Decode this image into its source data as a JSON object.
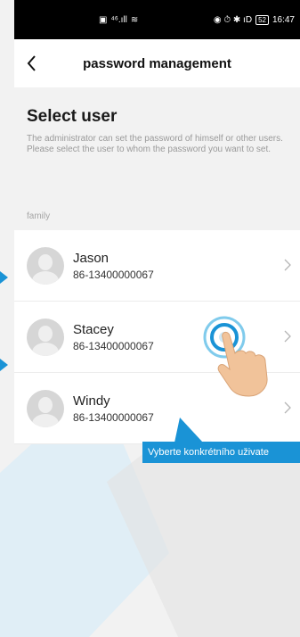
{
  "status_bar": {
    "signal_text": "⁴⁶.ıll",
    "right_icons": "◉ ⏱ ✱ ıD",
    "battery": "52",
    "time": "16:47"
  },
  "nav": {
    "title": "password management",
    "back_icon": "chevron-left"
  },
  "header": {
    "title": "Select user",
    "description": "The administrator can set the password of himself or other users. Please select the user to whom the password you want to set."
  },
  "section": {
    "label": "family"
  },
  "users": [
    {
      "name": "Jason",
      "phone": "86-13400000067"
    },
    {
      "name": "Stacey",
      "phone": "86-13400000067"
    },
    {
      "name": "Windy",
      "phone": "86-13400000067"
    }
  ],
  "callout": {
    "text": "Vyberte konkrétního uživate"
  },
  "colors": {
    "accent": "#1a93d6",
    "background": "#f2f2f2",
    "card": "#ffffff"
  }
}
